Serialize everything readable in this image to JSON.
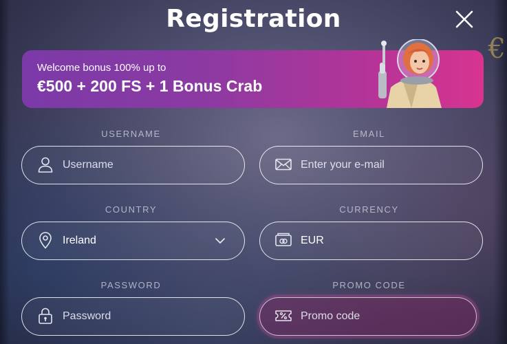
{
  "modal": {
    "title": "Registration",
    "close_icon": "close-icon"
  },
  "banner": {
    "line1": "Welcome bonus 100% up to",
    "line2": "€500 + 200 FS + 1 Bonus Crab",
    "gradient": [
      "#7b3aa8",
      "#d83490"
    ]
  },
  "form": {
    "username": {
      "label": "USERNAME",
      "placeholder": "Username",
      "icon": "user-icon"
    },
    "email": {
      "label": "EMAIL",
      "placeholder": "Enter your e-mail",
      "icon": "envelope-icon"
    },
    "country": {
      "label": "COUNTRY",
      "value": "Ireland",
      "icon": "location-pin-icon",
      "dropdown_icon": "chevron-down-icon"
    },
    "currency": {
      "label": "CURRENCY",
      "value": "EUR",
      "icon": "wallet-icon"
    },
    "password": {
      "label": "PASSWORD",
      "placeholder": "Password",
      "icon": "lock-icon"
    },
    "promo": {
      "label": "PROMO CODE",
      "placeholder": "Promo code",
      "icon": "percent-ticket-icon"
    }
  },
  "colors": {
    "field_border": "#ffffff",
    "promo_highlight": "#aa468c",
    "label": "#d7d7e6"
  }
}
